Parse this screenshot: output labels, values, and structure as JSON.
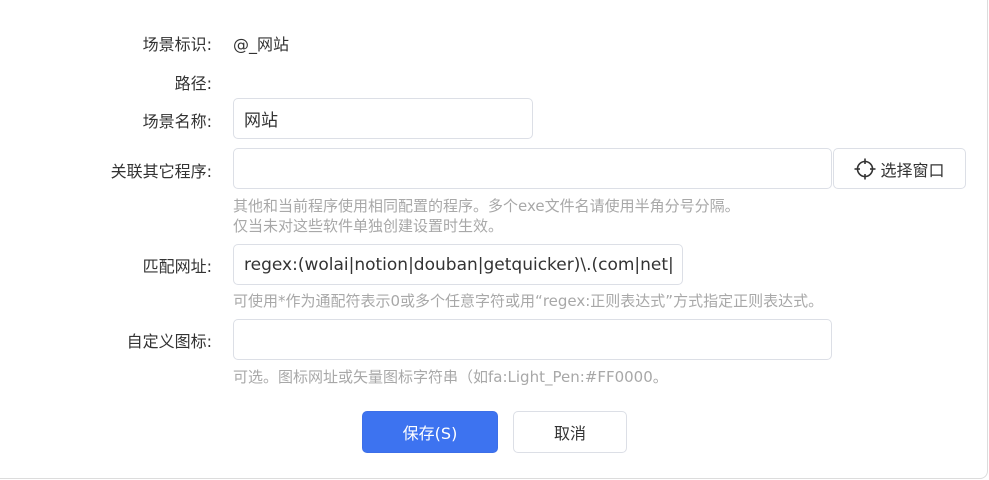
{
  "form": {
    "scene_id": {
      "label": "场景标识:",
      "value": "@_网站"
    },
    "path": {
      "label": "路径:",
      "value": ""
    },
    "scene_name": {
      "label": "场景名称:",
      "value": "网站"
    },
    "related_programs": {
      "label": "关联其它程序:",
      "value": "",
      "hint_line1": "其他和当前程序使用相同配置的程序。多个exe文件名请使用半角分号分隔。",
      "hint_line2": "仅当未对这些软件单独创建设置时生效。",
      "select_window_label": "选择窗口",
      "select_window_icon": "crosshair-icon"
    },
    "match_url": {
      "label": "匹配网址:",
      "value": "regex:(wolai|notion|douban|getquicker)\\.(com|net|",
      "hint": "可使用*作为通配符表示0或多个任意字符或用“regex:正则表达式”方式指定正则表达式。"
    },
    "custom_icon": {
      "label": "自定义图标:",
      "value": "",
      "hint": "可选。图标网址或矢量图标字符串（如fa:Light_Pen:#FF0000。"
    }
  },
  "actions": {
    "save_label": "保存(S)",
    "cancel_label": "取消"
  },
  "colors": {
    "primary": "#3d73f0",
    "hint_text": "#a8a8a8",
    "border": "#dcdfe6"
  }
}
